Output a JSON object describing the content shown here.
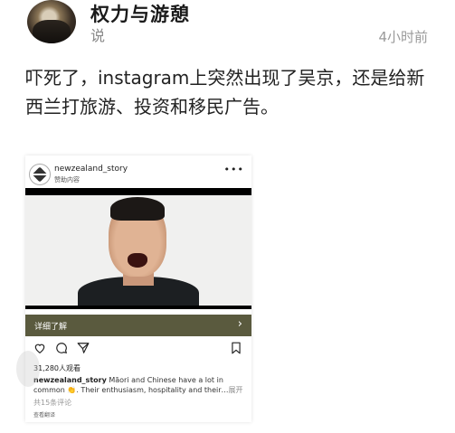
{
  "post": {
    "author": "权力与游憩",
    "author_sub": "说",
    "time": "4小时前",
    "text": "吓死了，instagram上突然出现了吴京，还是给新西兰打旅游、投资和移民广告。"
  },
  "instagram": {
    "username": "newzealand_story",
    "sponsored": "赞助内容",
    "more": "•••",
    "cta_label": "详细了解",
    "cta_arrow": "›",
    "likes": "31,280人观看",
    "caption_user": "newzealand_story",
    "caption_text": " Māori and Chinese have a lot in common 👏. Their enthusiasm, hospitality and their…",
    "caption_more": "展开",
    "comments": "共15条评论",
    "translate": "查看翻译"
  },
  "icons": [
    "heart-icon",
    "comment-icon",
    "share-icon",
    "bookmark-icon"
  ]
}
